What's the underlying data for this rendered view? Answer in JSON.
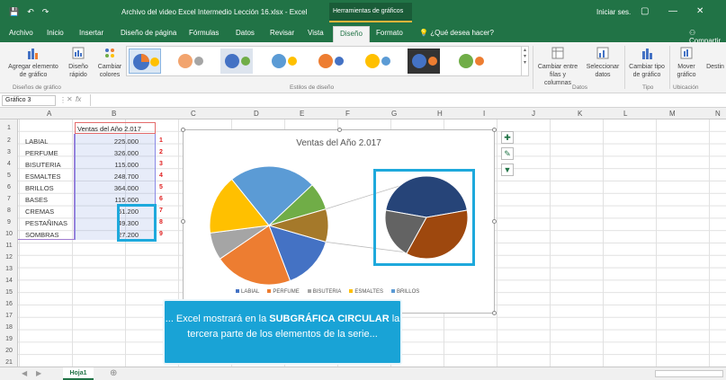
{
  "titlebar": {
    "document_title": "Archivo del video Excel Intermedio Lección 16.xlsx - Excel",
    "context_tools": "Herramientas de gráficos",
    "user": "Iniciar ses.",
    "restore": "▢",
    "minimize": "—",
    "close": "✕"
  },
  "tabs": [
    "Archivo",
    "Inicio",
    "Insertar",
    "Diseño de página",
    "Fórmulas",
    "Datos",
    "Revisar",
    "Vista",
    "Diseño",
    "Formato"
  ],
  "tell_me": "¿Qué desea hacer?",
  "share": "Compartir",
  "ribbon": {
    "add_element": "Agregar elemento de gráfico",
    "quick_layout": "Diseño rápido",
    "change_colors": "Cambiar colores",
    "group_layouts": "Diseños de gráfico",
    "group_styles": "Estilos de diseño",
    "switch_rowcol": "Cambiar entre filas y columnas",
    "select_data": "Seleccionar datos",
    "group_data": "Datos",
    "change_type": "Cambiar tipo de gráfico",
    "group_type": "Tipo",
    "move_chart": "Mover gráfico",
    "group_location": "Ubicación",
    "right_cut": "Destin"
  },
  "formula_bar": {
    "name_box": "Gráfico 3",
    "fx": "fx"
  },
  "columns": [
    "A",
    "B",
    "C",
    "D",
    "E",
    "F",
    "G",
    "H",
    "I",
    "J",
    "K",
    "L",
    "M",
    "N"
  ],
  "rows": [
    "1",
    "2",
    "3",
    "4",
    "5",
    "6",
    "7",
    "8",
    "9",
    "10",
    "11",
    "12",
    "13",
    "14",
    "15",
    "16",
    "17",
    "18",
    "19",
    "20",
    "21"
  ],
  "sheet": {
    "header_b1": "Ventas del Año 2.017",
    "items": [
      {
        "name": "LABIAL",
        "value": "225.000",
        "n": "1"
      },
      {
        "name": "PERFUME",
        "value": "326.000",
        "n": "2"
      },
      {
        "name": "BISUTERIA",
        "value": "115.000",
        "n": "3"
      },
      {
        "name": "ESMALTES",
        "value": "248.700",
        "n": "4"
      },
      {
        "name": "BRILLOS",
        "value": "364.000",
        "n": "5"
      },
      {
        "name": "BASES",
        "value": "115.000",
        "n": "6"
      },
      {
        "name": "CREMAS",
        "value": "61.200",
        "n": "7"
      },
      {
        "name": "PESTAÑINAS",
        "value": "49.300",
        "n": "8"
      },
      {
        "name": "SOMBRAS",
        "value": "27.200",
        "n": "9"
      }
    ]
  },
  "chart": {
    "title": "Ventas del Año 2.017",
    "legend": [
      "LABIAL",
      "PERFUME",
      "BISUTERIA",
      "ESMALTES",
      "BRILLOS"
    ],
    "legend_colors": [
      "#4472c4",
      "#ed7d31",
      "#a5a5a5",
      "#ffc000",
      "#5b9bd5"
    ]
  },
  "chart_data": {
    "type": "pie",
    "title": "Ventas del Año 2.017",
    "categories": [
      "LABIAL",
      "PERFUME",
      "BISUTERIA",
      "ESMALTES",
      "BRILLOS",
      "BASES",
      "CREMAS",
      "PESTAÑINAS",
      "SOMBRAS"
    ],
    "values": [
      225000,
      326000,
      115000,
      248700,
      364000,
      115000,
      61200,
      49300,
      27200
    ],
    "colors": [
      "#4472c4",
      "#ed7d31",
      "#a5a5a5",
      "#ffc000",
      "#5b9bd5",
      "#70ad47",
      "#264478",
      "#9e480e",
      "#636363"
    ],
    "subplot": "pie of pie",
    "subplot_points": 3,
    "legend_position": "bottom"
  },
  "callout": {
    "prefix": "... Excel mostrará en la ",
    "bold1": "SUBGRÁFICA CIRCULAR",
    "suffix": " la tercera parte de los elementos de la serie..."
  },
  "sheet_tab": "Hoja1",
  "add_sheet": "⊕"
}
